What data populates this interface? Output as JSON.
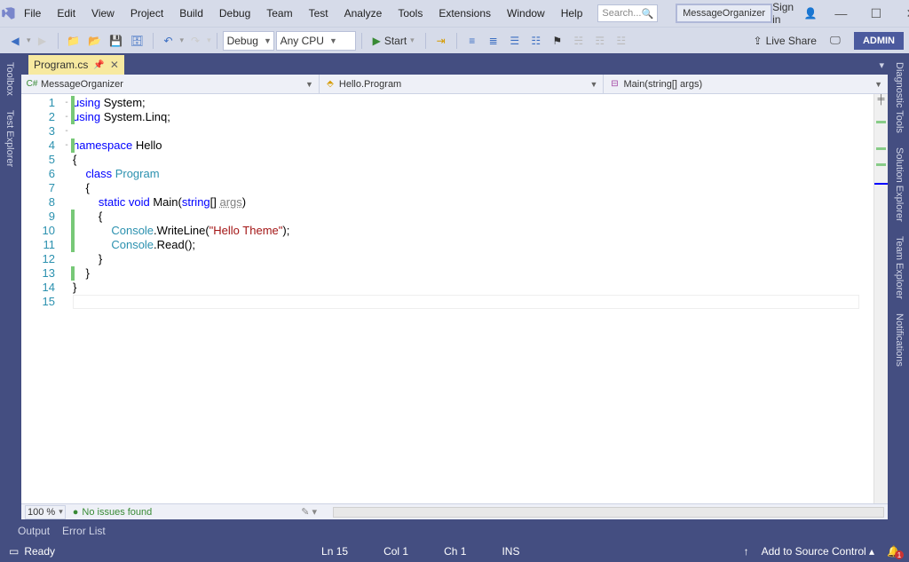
{
  "menu": {
    "items": [
      "File",
      "Edit",
      "View",
      "Project",
      "Build",
      "Debug",
      "Team",
      "Test",
      "Analyze",
      "Tools",
      "Extensions",
      "Window",
      "Help"
    ],
    "search_placeholder": "Search...",
    "solution_name": "MessageOrganizer",
    "signin": "Sign in",
    "window_controls": {
      "minimize": "—",
      "maximize": "☐",
      "close": "✕"
    }
  },
  "toolbar": {
    "config": "Debug",
    "platform": "Any CPU",
    "start": "Start",
    "live_share": "Live Share",
    "admin": "ADMIN"
  },
  "side_tabs_left": [
    "Toolbox",
    "Test Explorer"
  ],
  "side_tabs_right": [
    "Diagnostic Tools",
    "Solution Explorer",
    "Team Explorer",
    "Notifications"
  ],
  "doc_tab": {
    "name": "Program.cs"
  },
  "navbar": {
    "project": "MessageOrganizer",
    "class": "Hello.Program",
    "method": "Main(string[] args)"
  },
  "code": {
    "lines": [
      {
        "n": 1,
        "fold": "-",
        "ch": true,
        "tokens": [
          {
            "t": "using ",
            "c": "kw"
          },
          {
            "t": "System;",
            "c": ""
          }
        ]
      },
      {
        "n": 2,
        "fold": "",
        "ch": true,
        "tokens": [
          {
            "t": "using ",
            "c": "kw"
          },
          {
            "t": "System.Linq;",
            "c": ""
          }
        ]
      },
      {
        "n": 3,
        "fold": "",
        "ch": false,
        "tokens": [
          {
            "t": "",
            "c": ""
          }
        ]
      },
      {
        "n": 4,
        "fold": "-",
        "ch": true,
        "tokens": [
          {
            "t": "namespace ",
            "c": "kw"
          },
          {
            "t": "Hello",
            "c": ""
          }
        ]
      },
      {
        "n": 5,
        "fold": "",
        "ch": false,
        "tokens": [
          {
            "t": "{",
            "c": ""
          }
        ]
      },
      {
        "n": 6,
        "fold": "-",
        "ch": false,
        "tokens": [
          {
            "t": "    ",
            "c": ""
          },
          {
            "t": "class ",
            "c": "kw"
          },
          {
            "t": "Program",
            "c": "cls"
          }
        ]
      },
      {
        "n": 7,
        "fold": "",
        "ch": false,
        "tokens": [
          {
            "t": "    {",
            "c": ""
          }
        ]
      },
      {
        "n": 8,
        "fold": "-",
        "ch": false,
        "tokens": [
          {
            "t": "        ",
            "c": ""
          },
          {
            "t": "static ",
            "c": "kw"
          },
          {
            "t": "void ",
            "c": "kw"
          },
          {
            "t": "Main(",
            "c": ""
          },
          {
            "t": "string",
            "c": "kw"
          },
          {
            "t": "[] ",
            "c": ""
          },
          {
            "t": "args",
            "c": "param"
          },
          {
            "t": ")",
            "c": ""
          }
        ]
      },
      {
        "n": 9,
        "fold": "",
        "ch": true,
        "tokens": [
          {
            "t": "        {",
            "c": ""
          }
        ]
      },
      {
        "n": 10,
        "fold": "",
        "ch": true,
        "tokens": [
          {
            "t": "            ",
            "c": ""
          },
          {
            "t": "Console",
            "c": "cls"
          },
          {
            "t": ".WriteLine(",
            "c": ""
          },
          {
            "t": "\"Hello Theme\"",
            "c": "str"
          },
          {
            "t": ");",
            "c": ""
          }
        ]
      },
      {
        "n": 11,
        "fold": "",
        "ch": true,
        "tokens": [
          {
            "t": "            ",
            "c": ""
          },
          {
            "t": "Console",
            "c": "cls"
          },
          {
            "t": ".Read();",
            "c": ""
          }
        ]
      },
      {
        "n": 12,
        "fold": "",
        "ch": false,
        "tokens": [
          {
            "t": "        }",
            "c": ""
          }
        ]
      },
      {
        "n": 13,
        "fold": "",
        "ch": true,
        "tokens": [
          {
            "t": "    }",
            "c": ""
          }
        ]
      },
      {
        "n": 14,
        "fold": "",
        "ch": false,
        "tokens": [
          {
            "t": "}",
            "c": ""
          }
        ]
      },
      {
        "n": 15,
        "fold": "",
        "ch": false,
        "tokens": [
          {
            "t": "",
            "c": ""
          }
        ]
      }
    ]
  },
  "zoom": {
    "value": "100 %",
    "issues": "No issues found"
  },
  "out_tabs": [
    "Output",
    "Error List"
  ],
  "status": {
    "ready": "Ready",
    "ln": "Ln 15",
    "col": "Col 1",
    "ch": "Ch 1",
    "ins": "INS",
    "source_control": "Add to Source Control",
    "notif_count": "1"
  }
}
